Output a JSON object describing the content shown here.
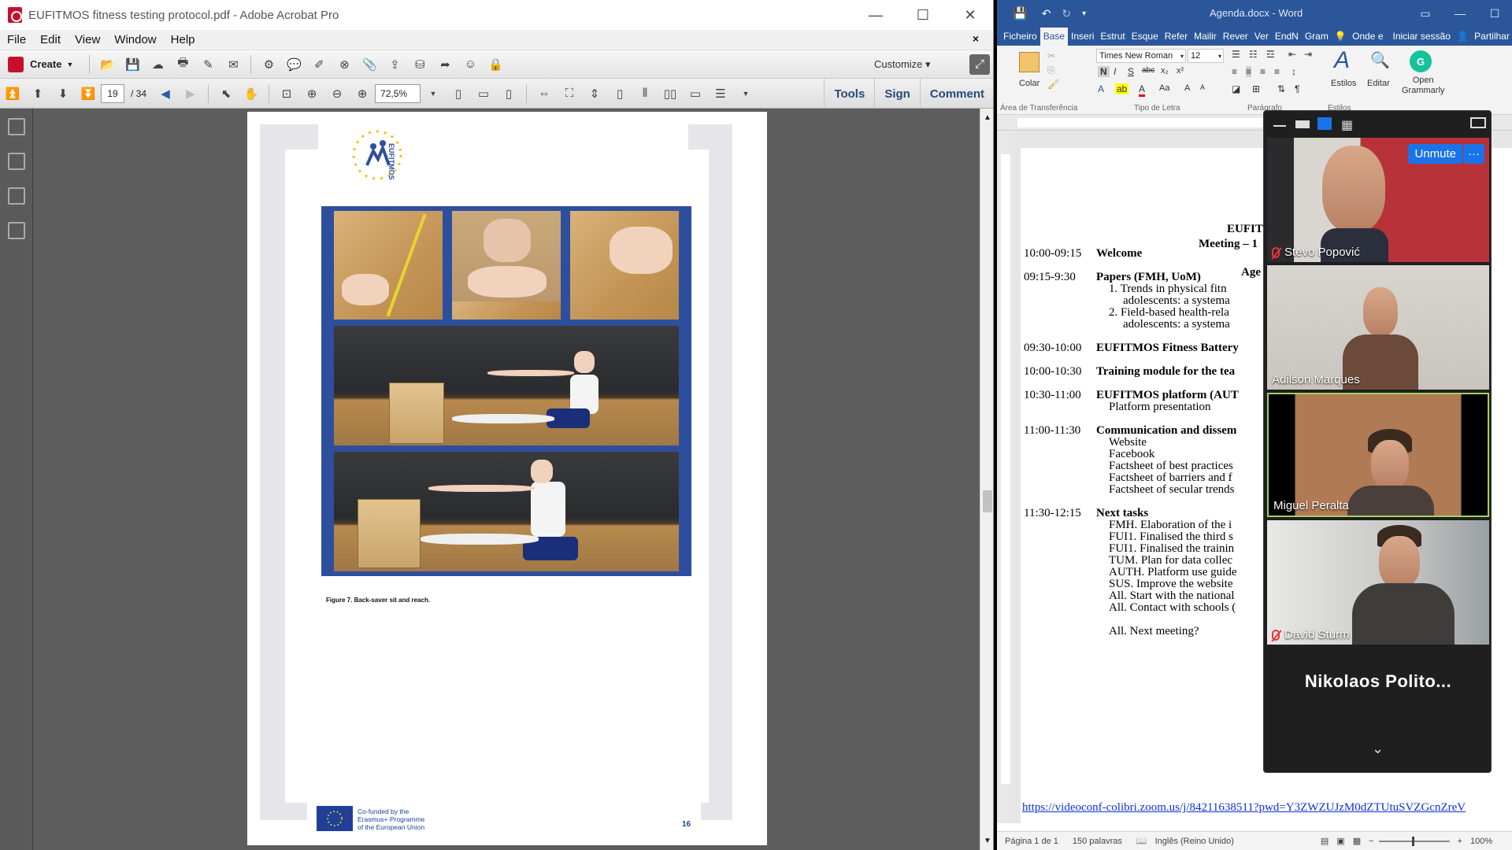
{
  "acrobat": {
    "title": "EUFITMOS fitness testing protocol.pdf - Adobe Acrobat Pro",
    "menu": [
      "File",
      "Edit",
      "View",
      "Window",
      "Help"
    ],
    "create_label": "Create",
    "customize_label": "Customize",
    "page_current": "19",
    "page_total": "/ 34",
    "zoom": "72,5%",
    "tabs": [
      "Tools",
      "Sign",
      "Comment"
    ],
    "pdf": {
      "logo_text": "EUFITMOS",
      "caption": "Figure 7. Back-saver sit and reach.",
      "footer_text": "Co-funded by the\nErasmus+ Programme\nof the European Union",
      "page_number": "16"
    }
  },
  "word": {
    "title": "Agenda.docx - Word",
    "tabs": [
      "Ficheiro",
      "Base",
      "Inseri",
      "Estrut",
      "Esque",
      "Refer",
      "Mailir",
      "Rever",
      "Ver",
      "EndN",
      "Gram"
    ],
    "tell_me": "Onde e",
    "signin": "Iniciar sessão",
    "share": "Partilhar",
    "font_name": "Times New Roman",
    "font_size": "12",
    "paste": "Colar",
    "styles": "Estilos",
    "edit": "Editar",
    "grammarly": "Open\nGrammarly",
    "group_clipboard": "Área de Transferência",
    "group_font": "Tipo de Letra",
    "group_paragraph": "Parágrafo",
    "group_styles": "Estilos",
    "doc": {
      "heading1": "EUFIT",
      "heading2": "Meeting – 1",
      "heading3": "Age",
      "lines": [
        {
          "time": "10:00-09:15",
          "text": "Welcome",
          "bold": true
        },
        {
          "time": "09:15-9:30",
          "text": "Papers (FMH, UoM)",
          "bold": true
        },
        {
          "time": "",
          "text": "1.    Trends in physical fitn",
          "bold": false
        },
        {
          "time": "",
          "text": "adolescents: a systema",
          "bold": false
        },
        {
          "time": "",
          "text": "2.    Field-based health-rela",
          "bold": false
        },
        {
          "time": "",
          "text": "adolescents: a systema",
          "bold": false
        },
        {
          "time": "09:30-10:00",
          "text": "EUFITMOS Fitness Battery",
          "bold": true
        },
        {
          "time": "10:00-10:30",
          "text": "Training module for the tea",
          "bold": true
        },
        {
          "time": "10:30-11:00",
          "text": "EUFITMOS platform (AUT",
          "bold": true
        },
        {
          "time": "",
          "text": "Platform presentation",
          "bold": false
        },
        {
          "time": "11:00-11:30",
          "text": "Communication and dissem",
          "bold": true
        },
        {
          "time": "",
          "text": "Website",
          "bold": false
        },
        {
          "time": "",
          "text": "Facebook",
          "bold": false
        },
        {
          "time": "",
          "text": "Factsheet of best practices",
          "bold": false
        },
        {
          "time": "",
          "text": "Factsheet of barriers and f",
          "bold": false
        },
        {
          "time": "",
          "text": "Factsheet of secular trends",
          "bold": false
        },
        {
          "time": "11:30-12:15",
          "text": "Next tasks",
          "bold": true
        },
        {
          "time": "",
          "text": "FMH. Elaboration of the i",
          "bold": false
        },
        {
          "time": "",
          "text": "FUI1. Finalised the third s",
          "bold": false
        },
        {
          "time": "",
          "text": "FUI1. Finalised the trainin",
          "bold": false
        },
        {
          "time": "",
          "text": "TUM. Plan for data collec",
          "bold": false
        },
        {
          "time": "",
          "text": "AUTH. Platform use guide",
          "bold": false
        },
        {
          "time": "",
          "text": "SUS. Improve the website",
          "bold": false
        },
        {
          "time": "",
          "text": "All. Start with the national",
          "bold": false
        },
        {
          "time": "",
          "text": "All. Contact with schools (",
          "bold": false
        },
        {
          "time": "",
          "text": "All. Next meeting?",
          "bold": false
        }
      ],
      "link": "https://videoconf-colibri.zoom.us/j/84211638511?pwd=Y3ZWZUJzM0dZTUtuSVZGcnZreV"
    },
    "status": {
      "page": "Página 1 de 1",
      "words": "150 palavras",
      "language": "Inglês (Reino Unido)",
      "zoom": "100%"
    }
  },
  "zoom": {
    "unmute_label": "Unmute",
    "more_label": "···",
    "participants": [
      {
        "name": "Stevo Popović",
        "muted": true
      },
      {
        "name": "Adilson Marques",
        "muted": false
      },
      {
        "name": "Miguel Peralta",
        "muted": false
      },
      {
        "name": "David Sturm",
        "muted": true
      }
    ],
    "audio_only_name": "Nikolaos  Polito..."
  },
  "colors": {
    "word_blue": "#2b579a",
    "zoom_blue": "#1a73e8",
    "pdf_frame": "#2e4f9e"
  }
}
